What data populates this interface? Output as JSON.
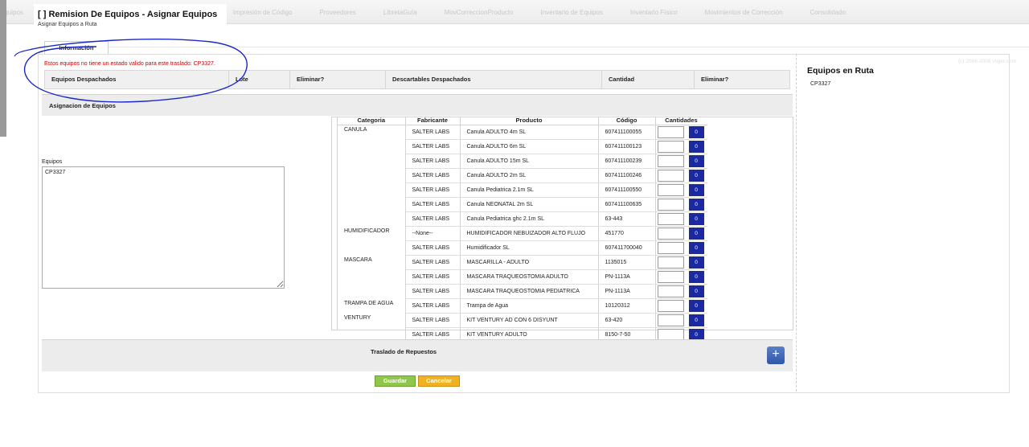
{
  "topbar": {
    "menu": [
      "Equipos",
      "InformeServicios",
      "AprobRecogidasPendientes",
      "Impresión de Código",
      "Proveedores",
      "LibretaGuía",
      "MovCorreccionProducto",
      "Inventario de Equipos",
      "Inventario Físico",
      "Movimientos de Corrección",
      "Consolidado"
    ]
  },
  "header": {
    "title": "[ ] Remision De Equipos - Asignar Equipos",
    "subtitle": "Asignar Equipos a Ruta"
  },
  "tab": {
    "label": "Información"
  },
  "error_message": "Estos equipos no tiene un estado valido para este traslado: CP3327.",
  "dispatched_header": {
    "col1": "Equipos Despachados",
    "col2": "Lote",
    "col3": "Eliminar?",
    "col4": "Descartables Despachados",
    "col5": "Cantidad",
    "col6": "Eliminar?"
  },
  "assignment": {
    "title": "Asignacion de Equipos",
    "equipos_label": "Equipos",
    "equipos_value": "CP3327"
  },
  "products_table": {
    "headers": [
      "Categoria",
      "Fabricante",
      "Producto",
      "Código",
      "Cantidades"
    ],
    "rows": [
      {
        "category": "CANULA",
        "fabricante": "SALTER LABS",
        "producto": "Canula ADULTO 4m SL",
        "codigo": "607411100055",
        "qty": "0"
      },
      {
        "category": "",
        "fabricante": "SALTER LABS",
        "producto": "Canula ADULTO 6m SL",
        "codigo": "607411100123",
        "qty": "0"
      },
      {
        "category": "",
        "fabricante": "SALTER LABS",
        "producto": "Canula ADULTO 15m SL",
        "codigo": "607411100239",
        "qty": "0"
      },
      {
        "category": "",
        "fabricante": "SALTER LABS",
        "producto": "Canula ADULTO 2m SL",
        "codigo": "607411100246",
        "qty": "0"
      },
      {
        "category": "",
        "fabricante": "SALTER LABS",
        "producto": "Canula Pediatrica 2.1m SL",
        "codigo": "607411100550",
        "qty": "0"
      },
      {
        "category": "",
        "fabricante": "SALTER LABS",
        "producto": "Canula NEONATAL 2m SL",
        "codigo": "607411100635",
        "qty": "0"
      },
      {
        "category": "",
        "fabricante": "SALTER LABS",
        "producto": "Canula Pediatrica ghc 2.1m SL",
        "codigo": "63-443",
        "qty": "0"
      },
      {
        "category": "HUMIDIFICADOR",
        "fabricante": "--None--",
        "producto": "HUMIDIFICADOR NEBUIZADOR ALTO FLUJO",
        "codigo": "451770",
        "qty": "0"
      },
      {
        "category": "",
        "fabricante": "SALTER LABS",
        "producto": "Humidificador SL",
        "codigo": "607411700040",
        "qty": "0"
      },
      {
        "category": "MASCARA",
        "fabricante": "SALTER LABS",
        "producto": "MASCARILLA - ADULTO",
        "codigo": "1135015",
        "qty": "0"
      },
      {
        "category": "",
        "fabricante": "SALTER LABS",
        "producto": "MASCARA TRAQUEOSTOMIA ADULTO",
        "codigo": "PN-1113A",
        "qty": "0"
      },
      {
        "category": "",
        "fabricante": "SALTER LABS",
        "producto": "MASCARA TRAQUEOSTOMIA PEDIATRICA",
        "codigo": "PN-1113A",
        "qty": "0"
      },
      {
        "category": "TRAMPA DE AGUA",
        "fabricante": "SALTER LABS",
        "producto": "Trampa de Agua",
        "codigo": "10120312",
        "qty": "0"
      },
      {
        "category": "VENTURY",
        "fabricante": "SALTER LABS",
        "producto": "KIT VENTURY AD CON 6 DISYUNT",
        "codigo": "63-420",
        "qty": "0"
      },
      {
        "category": "",
        "fabricante": "SALTER LABS",
        "producto": "KIT VENTURY ADULTO",
        "codigo": "8150-7-50",
        "qty": "0"
      }
    ]
  },
  "repuestos": {
    "title": "Traslado de Repuestos",
    "add_symbol": "+"
  },
  "buttons": {
    "save": "Guardar",
    "cancel": "Cancelar"
  },
  "right_panel": {
    "title": "Equipos en Ruta",
    "item": "CP3327"
  },
  "watermark": "(c) 2006-2009 vtiger.com",
  "colors": {
    "accent_blue": "#1b2aa0",
    "error_red": "#d00000",
    "save_green": "#8fc74a",
    "cancel_orange": "#f0b222",
    "annotation_ink": "#1a28c8"
  }
}
